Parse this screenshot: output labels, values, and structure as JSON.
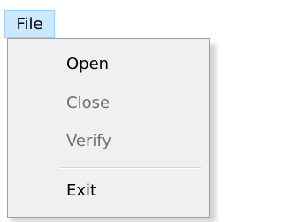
{
  "menubar": {
    "file_label": "File"
  },
  "menu": {
    "items": [
      {
        "label": "Open",
        "enabled": true
      },
      {
        "label": "Close",
        "enabled": false
      },
      {
        "label": "Verify",
        "enabled": false
      },
      {
        "label": "Exit",
        "enabled": true
      }
    ]
  },
  "colors": {
    "menubar_highlight": "#cce8ff",
    "menu_background": "#f0f0f0",
    "disabled_text": "#6d6d6d"
  }
}
